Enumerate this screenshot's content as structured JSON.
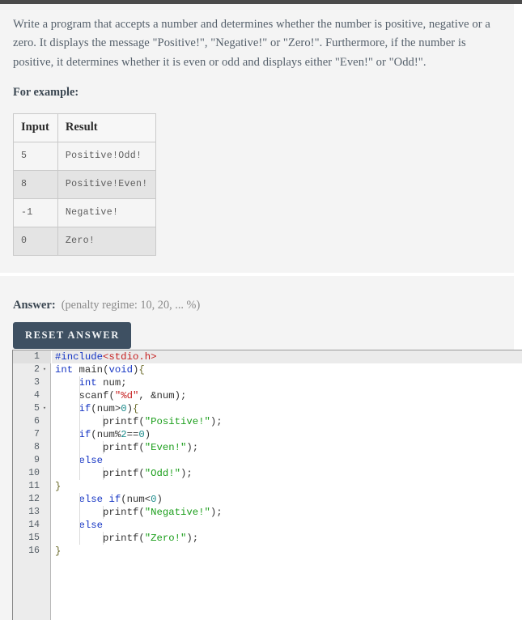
{
  "question": {
    "description": "Write a program that accepts a number and determines whether the number is positive, negative or a zero. It displays the message \"Positive!\", \"Negative!\" or \"Zero!\". Furthermore, if the number is positive, it determines whether it is even or odd and displays either \"Even!\" or \"Odd!\".",
    "for_example_label": "For example:",
    "table": {
      "headers": [
        "Input",
        "Result"
      ],
      "rows": [
        {
          "input": "5",
          "result": "Positive!Odd!"
        },
        {
          "input": "8",
          "result": "Positive!Even!"
        },
        {
          "input": "-1",
          "result": "Negative!"
        },
        {
          "input": "0",
          "result": "Zero!"
        }
      ]
    }
  },
  "answer": {
    "label": "Answer:",
    "penalty": "(penalty regime: 10, 20, ... %)",
    "reset_button": "RESET ANSWER"
  },
  "editor": {
    "active_line": 1,
    "fold_lines": [
      2,
      5
    ],
    "line_numbers": [
      "1",
      "2",
      "3",
      "4",
      "5",
      "6",
      "7",
      "8",
      "9",
      "10",
      "11",
      "12",
      "13",
      "14",
      "15",
      "16"
    ],
    "fold_glyph": "▾",
    "code": [
      "#include<stdio.h>",
      "int main(void){",
      "    int num;",
      "    scanf(\"%d\", &num);",
      "    if(num>0){",
      "        printf(\"Positive!\");",
      "    if(num%2==0)",
      "        printf(\"Even!\");",
      "    else",
      "        printf(\"Odd!\");",
      "}",
      "    else if(num<0)",
      "        printf(\"Negative!\");",
      "    else",
      "        printf(\"Zero!\");",
      "}"
    ]
  },
  "colors": {
    "page_bg": "#f4f4f4",
    "button_bg": "#3e5062",
    "text": "#55606b",
    "keyword": "#1535c4",
    "string": "#1a9e1a",
    "include_path": "#c62020",
    "number": "#1a8a8a"
  }
}
